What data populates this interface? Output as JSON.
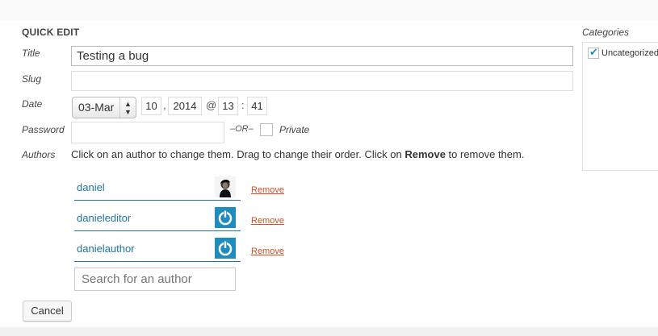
{
  "quick_edit": {
    "heading": "QUICK EDIT",
    "title_label": "Title",
    "title_value": "Testing a bug",
    "slug_label": "Slug",
    "slug_value": "",
    "date_label": "Date",
    "date": {
      "month": "03-Mar",
      "day": "10",
      "day_sep": ",",
      "year": "2014",
      "at": "@",
      "hour": "13",
      "time_sep": ":",
      "minute": "41"
    },
    "password_label": "Password",
    "password_value": "",
    "or_text": "–OR–",
    "private_label": "Private",
    "authors_label": "Authors",
    "authors_help": {
      "before": "Click on an author to change them. Drag to change their order. Click on ",
      "bold": "Remove",
      "after": " to remove them."
    },
    "authors": [
      {
        "name": "daniel",
        "avatar": "photo-avatar",
        "remove": "Remove"
      },
      {
        "name": "danieleditor",
        "avatar": "power-icon-avatar",
        "remove": "Remove"
      },
      {
        "name": "danielauthor",
        "avatar": "power-icon-avatar",
        "remove": "Remove"
      }
    ],
    "search_placeholder": "Search for an author",
    "cancel_label": "Cancel"
  },
  "categories": {
    "heading": "Categories",
    "items": [
      {
        "label": "Uncategorized",
        "checked": true
      }
    ]
  },
  "colors": {
    "accent": "#21759b",
    "remove_link": "#d54e21",
    "avatar_blue": "#1e8cbe"
  }
}
